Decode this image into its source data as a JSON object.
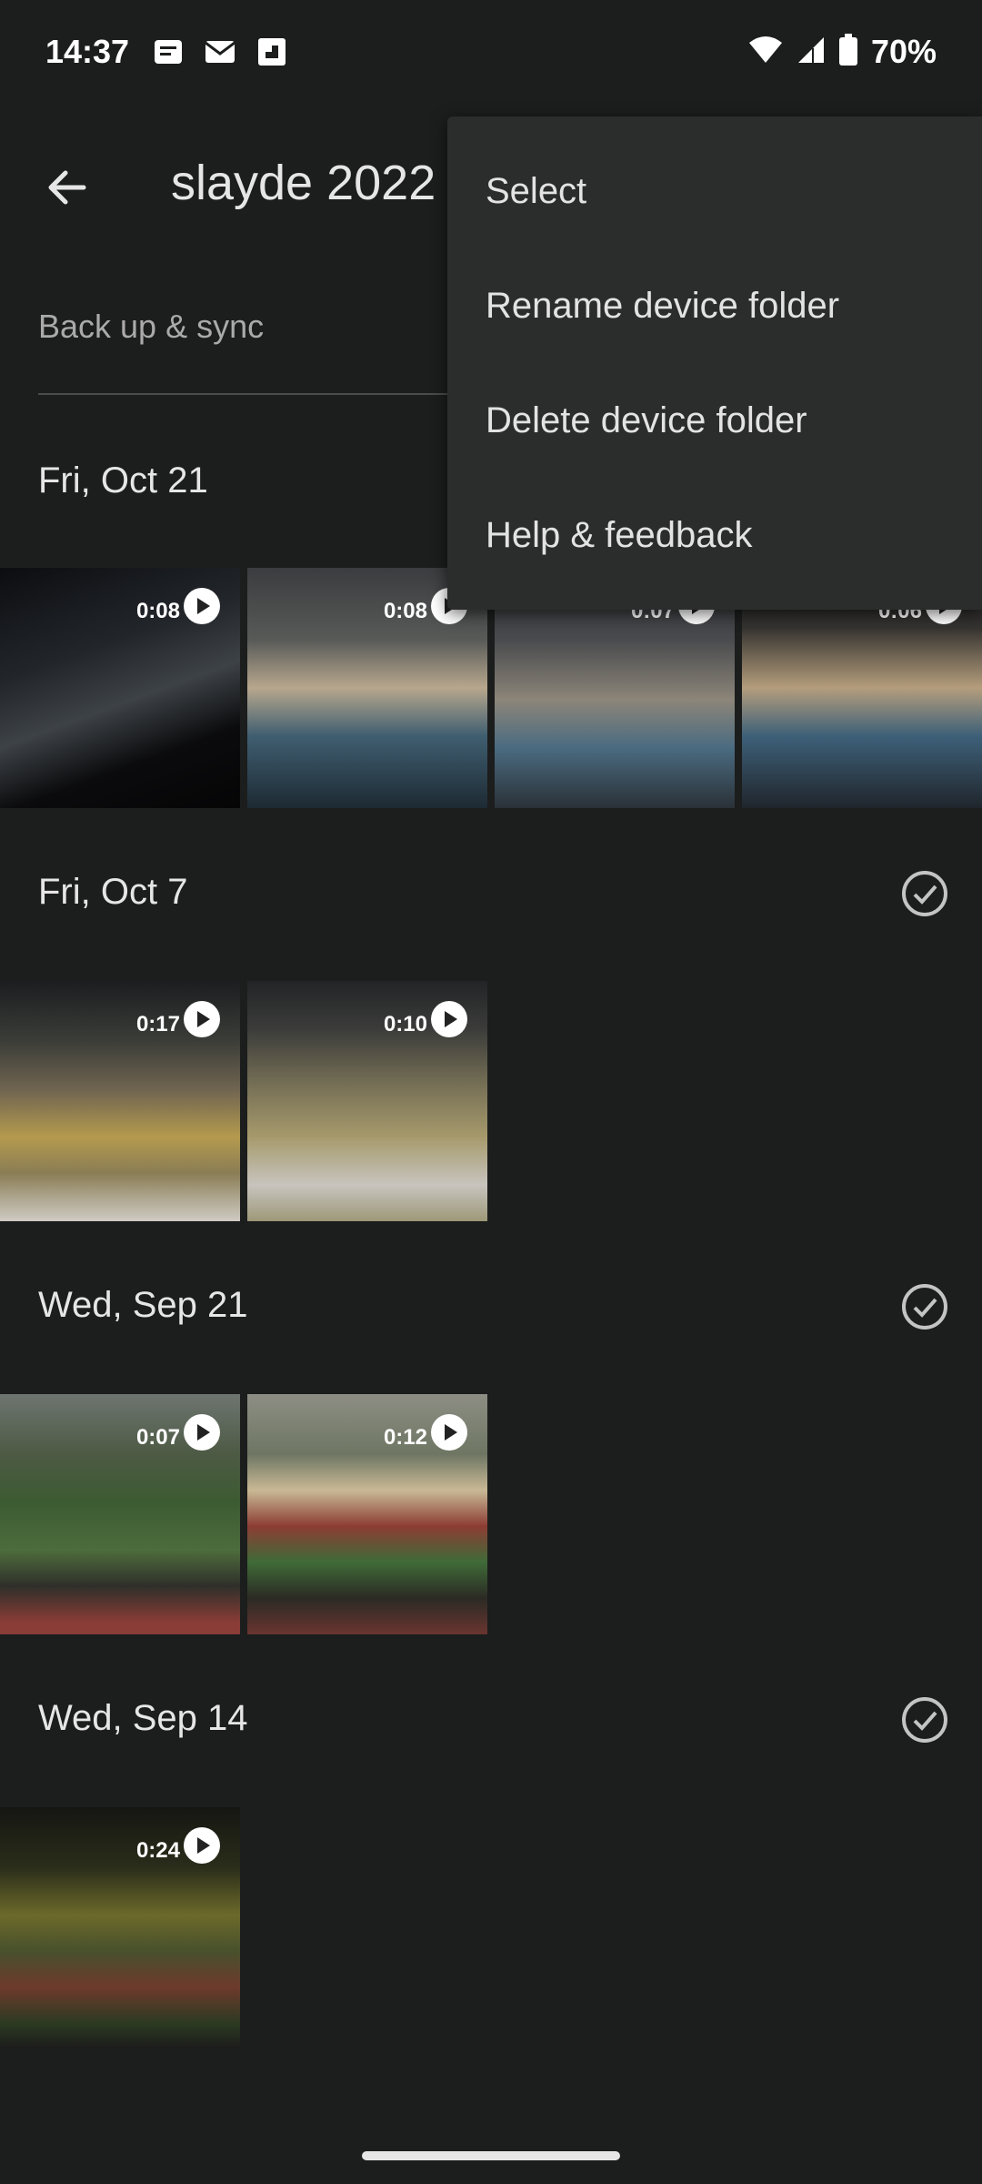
{
  "status": {
    "time": "14:37",
    "battery": "70%",
    "left_icons": [
      "notification-icon",
      "mail-icon",
      "flipboard-icon"
    ],
    "right_icons": [
      "wifi-icon",
      "signal-icon",
      "battery-icon"
    ]
  },
  "header": {
    "title": "slayde 2022",
    "back_icon": "arrow-back-icon"
  },
  "sync": {
    "label": "Back up & sync"
  },
  "menu": {
    "items": [
      {
        "label": "Select"
      },
      {
        "label": "Rename device folder"
      },
      {
        "label": "Delete device folder"
      },
      {
        "label": "Help & feedback"
      }
    ]
  },
  "sections": [
    {
      "date": "Fri, Oct 21",
      "videos": [
        {
          "duration": "0:08"
        },
        {
          "duration": "0:08"
        },
        {
          "duration": "0:07"
        },
        {
          "duration": "0:06"
        }
      ]
    },
    {
      "date": "Fri, Oct 7",
      "videos": [
        {
          "duration": "0:17"
        },
        {
          "duration": "0:10"
        }
      ]
    },
    {
      "date": "Wed, Sep 21",
      "videos": [
        {
          "duration": "0:07"
        },
        {
          "duration": "0:12"
        }
      ]
    },
    {
      "date": "Wed, Sep 14",
      "videos": [
        {
          "duration": "0:24"
        }
      ]
    }
  ]
}
